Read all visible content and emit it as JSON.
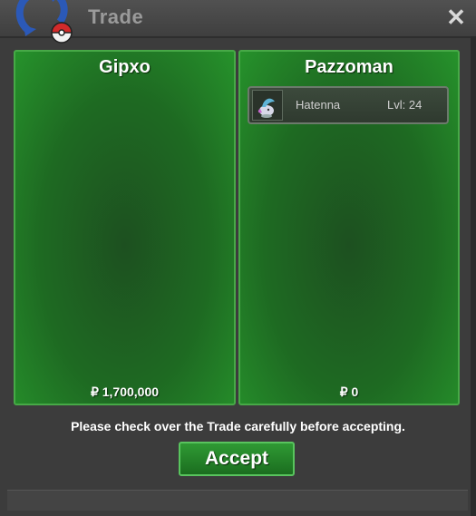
{
  "window": {
    "title": "Trade",
    "close_icon": "close-icon"
  },
  "trade": {
    "left": {
      "player_name": "Gipxo",
      "money": "₽ 1,700,000"
    },
    "right": {
      "player_name": "Pazzoman",
      "money": "₽ 0",
      "pokemon": [
        {
          "name": "Hatenna",
          "level": "Lvl: 24",
          "icon": "hatenna-sprite-icon"
        }
      ]
    }
  },
  "footer": {
    "notice": "Please check over the Trade carefully before accepting.",
    "accept_label": "Accept"
  },
  "colors": {
    "panel_border": "#47a947",
    "panel_green": "#1e6a22",
    "accept_green": "#2f9a34"
  }
}
